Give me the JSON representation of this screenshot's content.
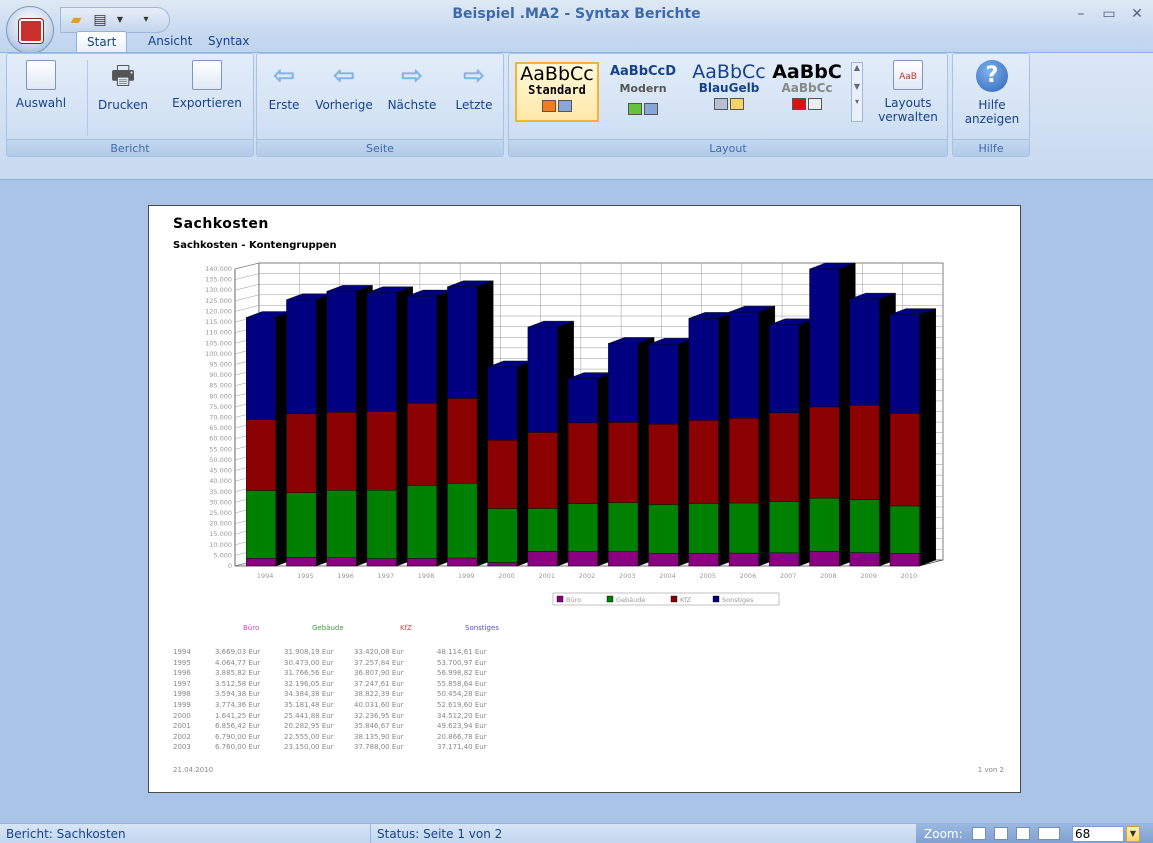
{
  "window": {
    "title": "Beispiel .MA2 - Syntax Berichte"
  },
  "tabs": [
    {
      "label": "Start"
    },
    {
      "label": "Ansicht"
    },
    {
      "label": "Syntax"
    }
  ],
  "ribbon": {
    "bericht": {
      "label": "Bericht",
      "auswahl": "Auswahl",
      "drucken": "Drucken",
      "exportieren": "Exportieren"
    },
    "seite": {
      "label": "Seite",
      "erste": "Erste",
      "vorherige": "Vorherige",
      "naechste": "Nächste",
      "letzte": "Letzte"
    },
    "layout": {
      "label": "Layout",
      "styles": [
        {
          "big": "AaBbCc",
          "sub": "Standard",
          "colors": [
            "#f47b20",
            "#8aa6d6"
          ]
        },
        {
          "big": "AaBbCcD",
          "sub": "Modern",
          "colors": [
            "#66c13c",
            "#8aa6d6"
          ]
        },
        {
          "big": "AaBbCc",
          "sub": "BlauGelb",
          "colors": [
            "#b8bfd4",
            "#f4d464"
          ]
        },
        {
          "big": "AaBbC",
          "sub": "AaBbCc",
          "colors": [
            "#e01010",
            "#ededed"
          ]
        }
      ],
      "manage_line1": "Layouts",
      "manage_line2": "verwalten"
    },
    "hilfe": {
      "label": "Hilfe",
      "btn_line1": "Hilfe",
      "btn_line2": "anzeigen"
    }
  },
  "report": {
    "title": "Sachkosten",
    "subtitle": "Sachkosten - Kontengruppen",
    "date": "21.04.2010",
    "page": "1 von 2"
  },
  "chart_data": {
    "type": "bar",
    "stacked": true,
    "three_d": true,
    "title": "Sachkosten - Kontengruppen",
    "categories": [
      "1994",
      "1995",
      "1996",
      "1997",
      "1998",
      "1999",
      "2000",
      "2001",
      "2002",
      "2003",
      "2004",
      "2005",
      "2006",
      "2007",
      "2008",
      "2009",
      "2010"
    ],
    "ylim": [
      0,
      140000
    ],
    "ytick_step": 5000,
    "grid": true,
    "legend_position": "bottom",
    "series": [
      {
        "name": "Büro",
        "color": "#8b0080",
        "values": [
          3669,
          4065,
          3886,
          3513,
          3594,
          3774,
          1641,
          6856,
          6790,
          6760,
          6000,
          6000,
          6100,
          6200,
          7000,
          6300,
          6000
        ]
      },
      {
        "name": "Gebäude",
        "color": "#008000",
        "values": [
          31908,
          30473,
          31767,
          32196,
          34384,
          35181,
          25442,
          20283,
          22555,
          23150,
          23000,
          23500,
          23600,
          24200,
          25000,
          25000,
          22300
        ]
      },
      {
        "name": "KfZ",
        "color": "#8b0000",
        "values": [
          33420,
          37258,
          36808,
          37248,
          38822,
          40032,
          32237,
          35847,
          38136,
          37788,
          37800,
          39200,
          40000,
          41800,
          43000,
          44500,
          43700
        ]
      },
      {
        "name": "Sonstiges",
        "color": "#000080",
        "values": [
          48115,
          53701,
          56999,
          55859,
          50454,
          52620,
          34512,
          49624,
          20867,
          37171,
          37700,
          48000,
          50000,
          41500,
          65000,
          50000,
          46500
        ]
      }
    ],
    "ytick_labels": [
      "0",
      "5.000",
      "10.000",
      "15.000",
      "20.000",
      "25.000",
      "30.000",
      "35.000",
      "40.000",
      "45.000",
      "50.000",
      "55.000",
      "60.000",
      "65.000",
      "70.000",
      "75.000",
      "80.000",
      "85.000",
      "90.000",
      "95.000",
      "100.000",
      "105.000",
      "110.000",
      "115.000",
      "120.000",
      "125.000",
      "130.000",
      "135.000",
      "140.000"
    ]
  },
  "table": {
    "headers": [
      "Büro",
      "Gebäude",
      "KfZ",
      "Sonstiges"
    ],
    "header_colors": [
      "#c050c0",
      "#40a040",
      "#d04040",
      "#5050c0"
    ],
    "rows": [
      {
        "year": "1994",
        "cells": [
          "3.669,03 Eur",
          "31.908,19 Eur",
          "33.420,08 Eur",
          "48.114,61 Eur"
        ]
      },
      {
        "year": "1995",
        "cells": [
          "4.064,77 Eur",
          "30.473,00 Eur",
          "37.257,84 Eur",
          "53.700,97 Eur"
        ]
      },
      {
        "year": "1996",
        "cells": [
          "3.885,82 Eur",
          "31.766,56 Eur",
          "36.807,90 Eur",
          "56.998,82 Eur"
        ]
      },
      {
        "year": "1997",
        "cells": [
          "3.512,58 Eur",
          "32.196,05 Eur",
          "37.247,61 Eur",
          "55.858,64 Eur"
        ]
      },
      {
        "year": "1998",
        "cells": [
          "3.594,38 Eur",
          "34.384,38 Eur",
          "38.822,39 Eur",
          "50.454,28 Eur"
        ]
      },
      {
        "year": "1999",
        "cells": [
          "3.774,36 Eur",
          "35.181,48 Eur",
          "40.031,60 Eur",
          "52.619,60 Eur"
        ]
      },
      {
        "year": "2000",
        "cells": [
          "1.641,25 Eur",
          "25.441,88 Eur",
          "32.236,95 Eur",
          "34.512,20 Eur"
        ]
      },
      {
        "year": "2001",
        "cells": [
          "6.856,42 Eur",
          "20.282,95 Eur",
          "35.846,67 Eur",
          "49.623,94 Eur"
        ]
      },
      {
        "year": "2002",
        "cells": [
          "6.790,00 Eur",
          "22.555,00 Eur",
          "38.135,90 Eur",
          "20.866,78 Eur"
        ]
      },
      {
        "year": "2003",
        "cells": [
          "6.760,00 Eur",
          "23.150,00 Eur",
          "37.788,00 Eur",
          "37.171,40 Eur"
        ]
      }
    ]
  },
  "status": {
    "left": "Bericht: Sachkosten",
    "middle": "Status: Seite 1 von 2",
    "zoom_label": "Zoom:",
    "zoom_value": "68"
  }
}
